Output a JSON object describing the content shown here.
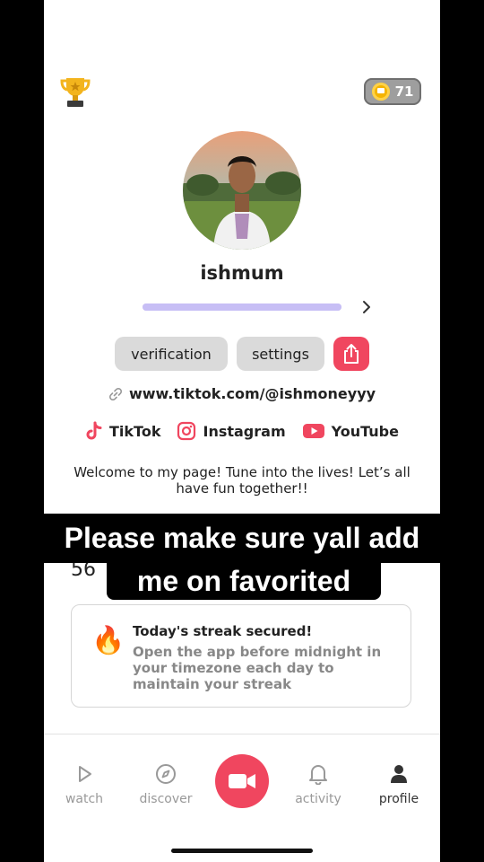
{
  "header": {
    "coin_count": "71"
  },
  "profile": {
    "username": "ishmum",
    "progress_fraction": 1.0,
    "buttons": {
      "verification": "verification",
      "settings": "settings"
    },
    "link": "www.tiktok.com/@ishmoneyyy",
    "socials": [
      {
        "label": "TikTok",
        "icon": "tiktok-icon"
      },
      {
        "label": "Instagram",
        "icon": "instagram-icon"
      },
      {
        "label": "YouTube",
        "icon": "youtube-icon"
      }
    ],
    "bio": "Welcome to my page! Tune into the lives! Let’s all have fun together!!"
  },
  "caption": {
    "line1": "Please make sure yall add",
    "line2": "me on favorited"
  },
  "streak": {
    "number": "56",
    "title": "Today's streak secured!",
    "description": "Open the app before midnight in your timezone each day to maintain your streak"
  },
  "nav": {
    "items": [
      {
        "label": "watch"
      },
      {
        "label": "discover"
      },
      {
        "label": "activity"
      },
      {
        "label": "profile"
      }
    ]
  },
  "colors": {
    "accent": "#f0465f",
    "progress": "#c7bef5",
    "coin": "#f5b400"
  }
}
